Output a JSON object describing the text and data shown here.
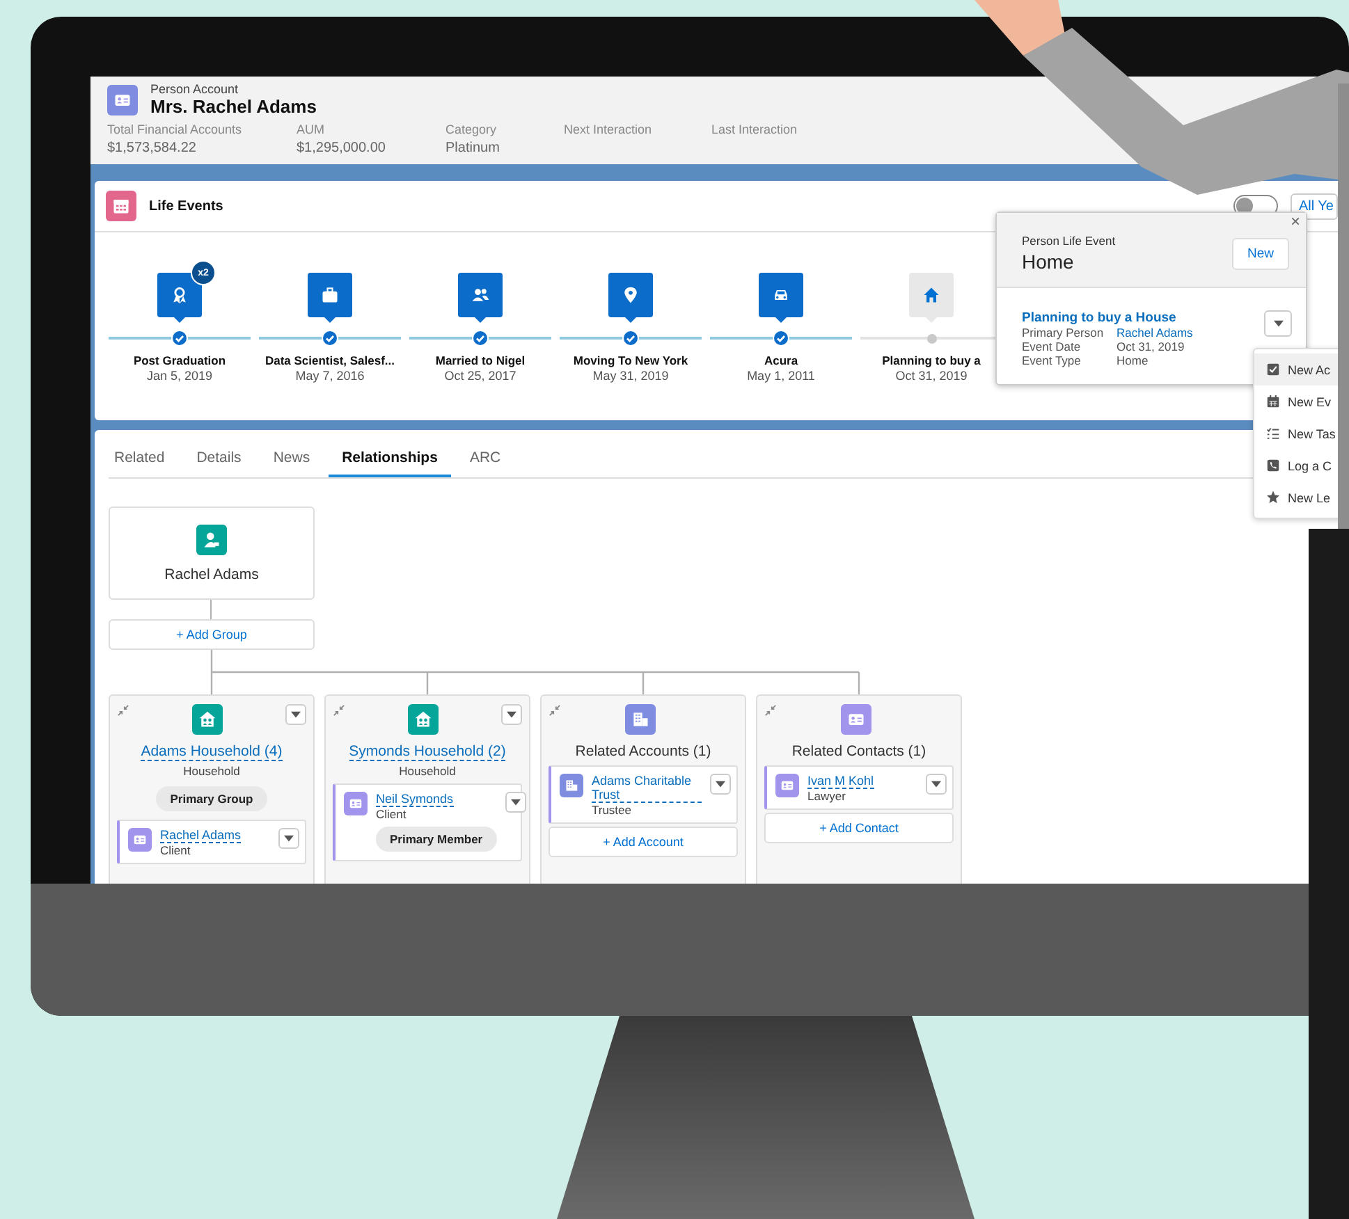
{
  "header": {
    "object_type": "Person Account",
    "name": "Mrs. Rachel Adams",
    "fields": [
      {
        "label": "Total Financial Accounts",
        "value": "$1,573,584.22"
      },
      {
        "label": "AUM",
        "value": "$1,295,000.00"
      },
      {
        "label": "Category",
        "value": "Platinum"
      },
      {
        "label": "Next Interaction"
      },
      {
        "label": "Last Interaction"
      }
    ]
  },
  "life_events": {
    "title": "Life Events",
    "toggle": {
      "on": false
    },
    "filter": "All Ye",
    "events": [
      {
        "kind": "graduation",
        "label": "Post Graduation",
        "date": "Jan 5, 2019",
        "badge": "x2",
        "completed": true
      },
      {
        "kind": "job",
        "label": "Data Scientist, Salesf...",
        "date": "May 7, 2016",
        "completed": true
      },
      {
        "kind": "marriage",
        "label": "Married to Nigel",
        "date": "Oct 25, 2017",
        "completed": true
      },
      {
        "kind": "move",
        "label": "Moving To New York",
        "date": "May 31, 2019",
        "completed": true
      },
      {
        "kind": "car",
        "label": "Acura",
        "date": "May 1, 2011",
        "completed": true
      },
      {
        "kind": "home",
        "label": "Planning to buy a",
        "date": "Oct 31, 2019",
        "completed": false
      }
    ]
  },
  "popover": {
    "subtitle": "Person Life Event",
    "title": "Home",
    "new_button": "New",
    "close": "×",
    "record": {
      "title": "Planning to buy a House",
      "fields": [
        {
          "label": "Primary Person",
          "value": "Rachel Adams",
          "link": true
        },
        {
          "label": "Event Date",
          "value": "Oct 31, 2019",
          "link": false
        },
        {
          "label": "Event Type",
          "value": "Home",
          "link": false
        }
      ]
    }
  },
  "action_menu": {
    "items": [
      {
        "kind": "opportunity",
        "label": "New Ac",
        "selected": true
      },
      {
        "kind": "event",
        "label": "New Ev",
        "selected": false
      },
      {
        "kind": "task",
        "label": "New Tas",
        "selected": false
      },
      {
        "kind": "call",
        "label": "Log a C",
        "selected": false
      },
      {
        "kind": "lead",
        "label": "New Le",
        "selected": false
      }
    ]
  },
  "tabs": [
    {
      "label": "Related",
      "selected": false
    },
    {
      "label": "Details",
      "selected": false
    },
    {
      "label": "News",
      "selected": false
    },
    {
      "label": "Relationships",
      "selected": true
    },
    {
      "label": "ARC",
      "selected": false
    }
  ],
  "relationships": {
    "root": {
      "name": "Rachel Adams"
    },
    "add_group": "+ Add Group",
    "groups": [
      {
        "kind": "household",
        "title": "Adams Household (4)",
        "link": true,
        "subtitle": "Household",
        "badge": "Primary Group",
        "members": [
          {
            "kind": "contact",
            "name": "Rachel Adams",
            "role": "Client"
          }
        ]
      },
      {
        "kind": "household",
        "title": "Symonds Household (2)",
        "link": true,
        "subtitle": "Household",
        "members": [
          {
            "kind": "contact",
            "name": "Neil Symonds",
            "role": "Client",
            "badge": "Primary Member"
          }
        ]
      },
      {
        "kind": "account",
        "title": "Related Accounts (1)",
        "link": false,
        "members": [
          {
            "kind": "account",
            "name": "Adams Charitable Trust",
            "role": "Trustee"
          }
        ],
        "add": "+ Add Account"
      },
      {
        "kind": "contact",
        "title": "Related Contacts (1)",
        "link": false,
        "members": [
          {
            "kind": "contact",
            "name": "Ivan M Kohl",
            "role": "Lawyer"
          }
        ],
        "add": "+ Add Contact"
      }
    ]
  }
}
